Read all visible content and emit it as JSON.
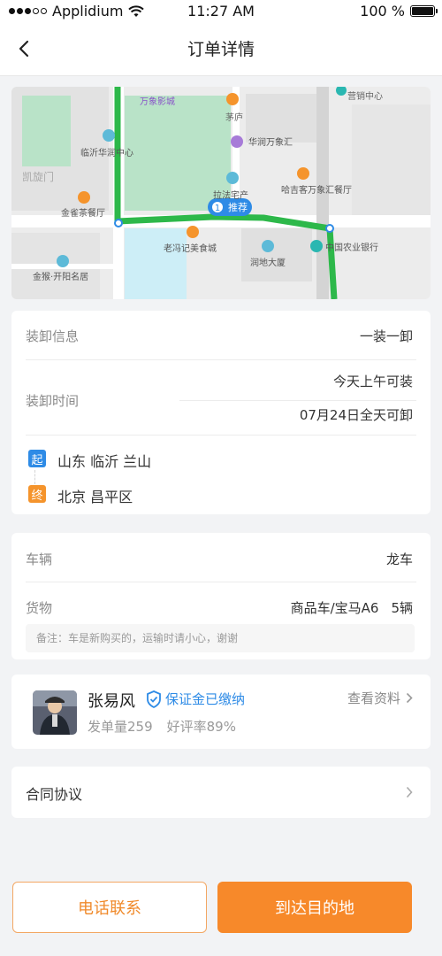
{
  "status_bar": {
    "carrier": "Applidium",
    "time": "11:27 AM",
    "battery": "100 %"
  },
  "nav": {
    "title": "订单详情",
    "back_icon": "chevron-left-icon"
  },
  "map": {
    "labels": {
      "wanxiang_cinema": "万象影城",
      "maolu": "茅庐",
      "yingxiao": "营销中心",
      "linyi_huarun": "临沂华润中心",
      "huarun_wanxianghui": "华润万象汇",
      "kaixuanmen": "凯旋门",
      "lafa": "拉法宅产",
      "haji": "哈吉客万象汇餐厅",
      "jinque": "金雀茶餐厅",
      "recommend": "推荐",
      "recommend_index": "1",
      "laofeng": "老冯记美食城",
      "runde": "润地大厦",
      "abc": "中国农业银行",
      "jinhou": "金猴·开阳名居"
    },
    "colors": {
      "route": "#2db84a",
      "park": "#b9e3c8",
      "water": "#cdeef7",
      "road": "#ffffff",
      "ground": "#ececec"
    }
  },
  "loading": {
    "info_label": "装卸信息",
    "info_value": "一装一卸",
    "time_label": "装卸时间",
    "time_value_1": "今天上午可装",
    "time_value_2": "07月24日全天可卸",
    "start_tag": "起",
    "start_place": "山东 临沂 兰山",
    "end_tag": "终",
    "end_place": "北京 昌平区"
  },
  "vehicle": {
    "vehicle_label": "车辆",
    "vehicle_value": "龙车",
    "cargo_label": "货物",
    "cargo_value": "商品车/宝马A6",
    "cargo_count": "5辆",
    "note": "备注：车是新购买的，运输时请小心，谢谢"
  },
  "driver": {
    "name": "张易风",
    "deposit": "保证金已缴纳",
    "view_profile": "查看资料",
    "orders": "发单量259",
    "rating": "好评率89%"
  },
  "contract": {
    "label": "合同协议"
  },
  "actions": {
    "phone": "电话联系",
    "arrive": "到达目的地"
  }
}
